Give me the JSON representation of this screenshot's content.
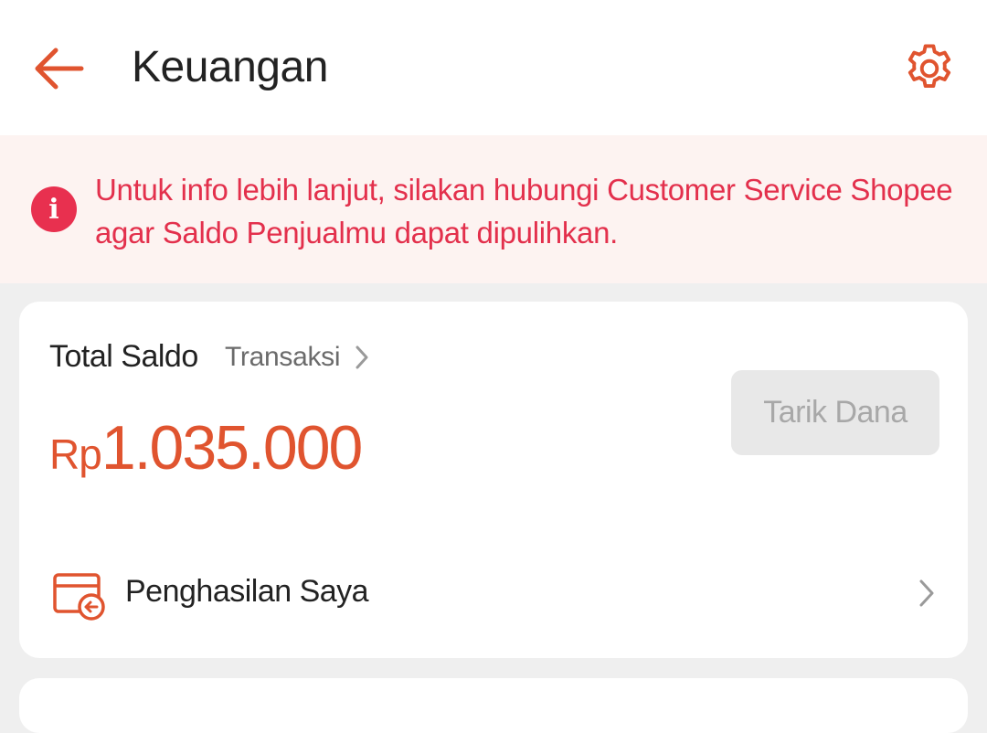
{
  "header": {
    "title": "Keuangan",
    "back_icon": "arrow-left-icon",
    "settings_icon": "gear-icon",
    "accent_color": "#e0542f"
  },
  "notice": {
    "icon": "info-icon",
    "icon_glyph": "i",
    "text": "Untuk info lebih lanjut, silakan hubungi Customer Service Shopee agar Saldo Penjualmu dapat dipulihkan.",
    "text_color": "#e3304c",
    "background": "#fdf3f1"
  },
  "balance_card": {
    "label": "Total Saldo",
    "transactions_link": "Transaksi",
    "currency": "Rp",
    "amount": "1.035.000",
    "withdraw_button": "Tarik Dana",
    "withdraw_enabled": false
  },
  "income_row": {
    "icon": "income-wallet-icon",
    "label": "Penghasilan Saya"
  }
}
